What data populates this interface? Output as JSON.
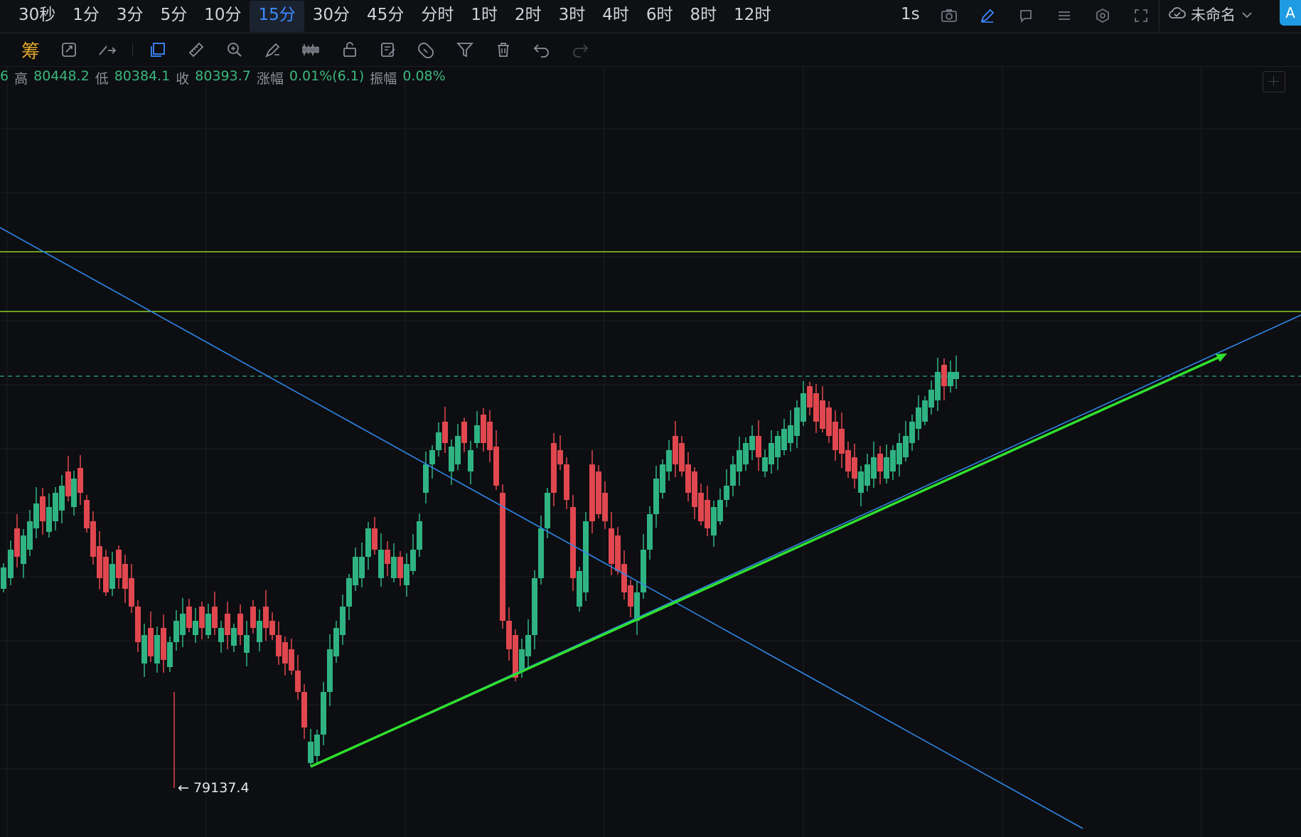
{
  "timeframes": [
    "30秒",
    "1分",
    "3分",
    "5分",
    "10分",
    "15分",
    "30分",
    "45分",
    "分时",
    "1时",
    "2时",
    "3时",
    "4时",
    "6时",
    "8时",
    "12时"
  ],
  "active_timeframe": "15分",
  "refresh_interval": "1s",
  "layout_name": "未命名",
  "corner_button": "A",
  "toolbar_first_label": "筹",
  "info": {
    "partial": "6",
    "high_label": "高",
    "high_value": "80448.2",
    "low_label": "低",
    "low_value": "80384.1",
    "close_label": "收",
    "close_value": "80393.7",
    "change_label": "涨幅",
    "change_value": "0.01%(6.1)",
    "amp_label": "振幅",
    "amp_value": "0.08%"
  },
  "chart_min_label": "← 79137.4",
  "colors": {
    "up": "#2fb383",
    "down": "#e0474f",
    "trend_blue": "#2f86e8",
    "trend_green": "#2fe02f",
    "horizontal_green": "#8ed12a",
    "dashed": "#2fa58f"
  },
  "chart_data": {
    "type": "candlestick",
    "interval": "15分",
    "lowest_marker": 79137.4,
    "last_bar": {
      "high": 80448.2,
      "low": 80384.1,
      "close": 80393.7,
      "change": "0.01%(6.1)",
      "amplitude": "0.08%"
    }
  }
}
